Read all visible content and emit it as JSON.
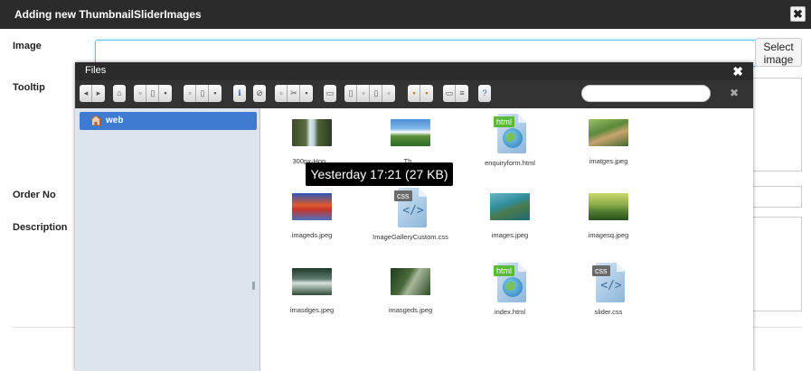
{
  "dialog": {
    "title": "Adding new ThumbnailSliderImages",
    "close_label": "✖",
    "fields": {
      "image": "Image",
      "tooltip": "Tooltip",
      "order_no": "Order No",
      "description": "Description"
    },
    "select_image_label": "Select image"
  },
  "files": {
    "title": "Files",
    "close_label": "✖",
    "search": {
      "value": "",
      "placeholder": ""
    },
    "search_clear": "✖",
    "tree": {
      "root_label": "web"
    },
    "items": [
      {
        "name": "300px-Hop...",
        "type": "image"
      },
      {
        "name": "Th...",
        "type": "image"
      },
      {
        "name": "enquiryform.html",
        "type": "html",
        "tag": "html"
      },
      {
        "name": "imatges.jpeg",
        "type": "image"
      },
      {
        "name": "imageds.jpeg",
        "type": "image"
      },
      {
        "name": "ImageGalleryCustom.css",
        "type": "css",
        "tag": "css"
      },
      {
        "name": "images.jpeg",
        "type": "image"
      },
      {
        "name": "imagesq.jpeg",
        "type": "image"
      },
      {
        "name": "imasdges.jpeg",
        "type": "image"
      },
      {
        "name": "imasgeds.jpeg",
        "type": "image"
      },
      {
        "name": "index.html",
        "type": "html",
        "tag": "html"
      },
      {
        "name": "slider.css",
        "type": "css",
        "tag": "css"
      }
    ],
    "tooltip": "Yesterday 17:21 (27 KB)"
  },
  "toolbar_icons": [
    "back-icon",
    "forward-icon",
    "home-icon",
    "new-folder-icon",
    "copy-icon",
    "paste-icon",
    "info-icon",
    "delete-icon",
    "view-icon",
    "help-icon"
  ]
}
